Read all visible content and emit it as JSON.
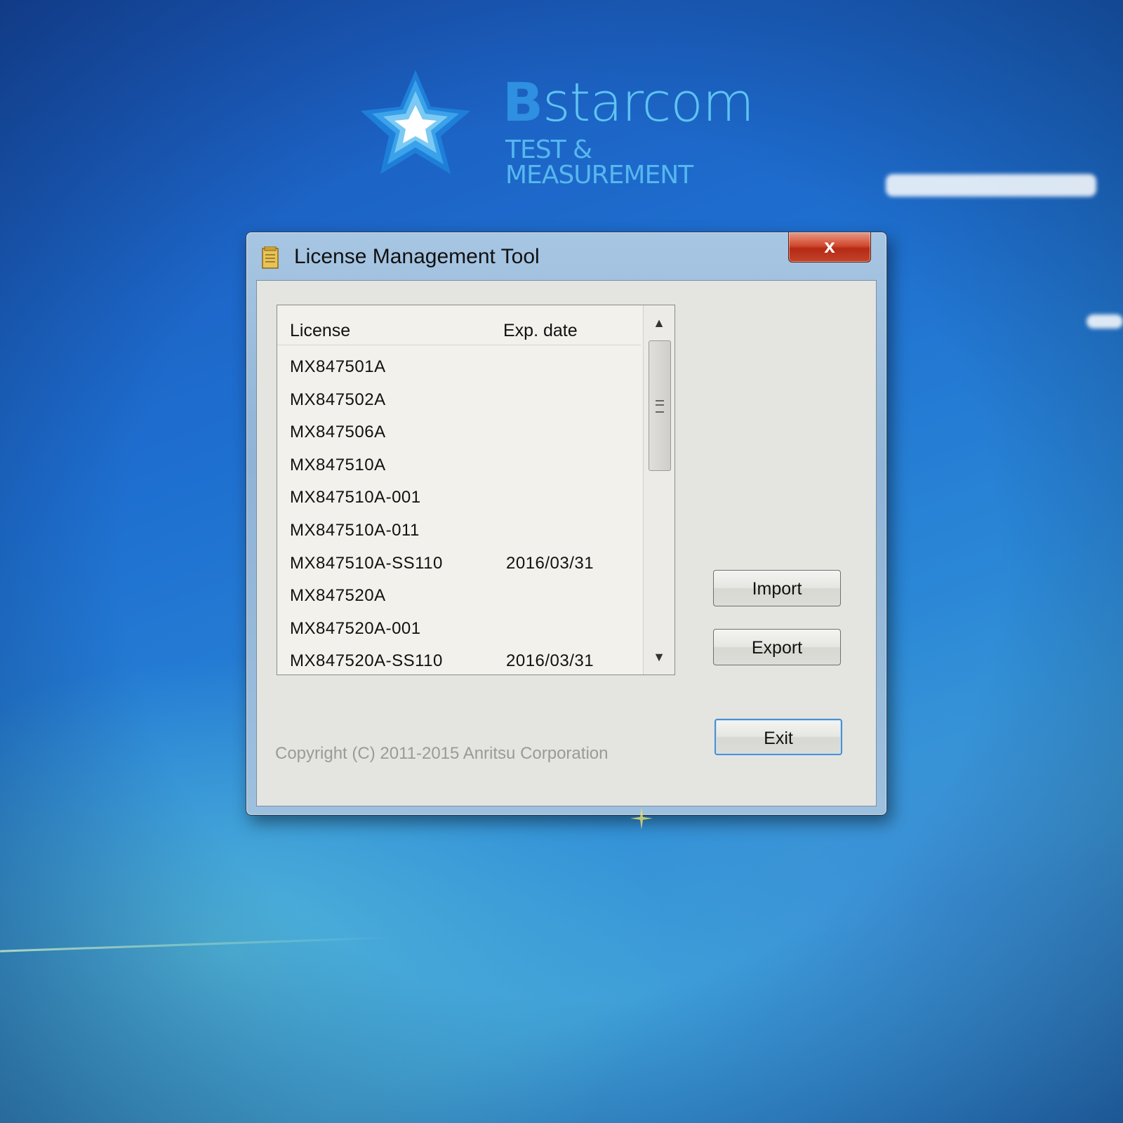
{
  "brand": {
    "initial": "B",
    "name_rest": "starcom",
    "subtitle": "TEST & MEASUREMENT"
  },
  "window": {
    "title": "License Management Tool",
    "close_label": "x",
    "icon": "document-icon"
  },
  "list": {
    "columns": {
      "license": "License",
      "exp_date": "Exp. date"
    },
    "rows": [
      {
        "license": "MX847501A",
        "exp": ""
      },
      {
        "license": "MX847502A",
        "exp": ""
      },
      {
        "license": "MX847506A",
        "exp": ""
      },
      {
        "license": "MX847510A",
        "exp": ""
      },
      {
        "license": "MX847510A-001",
        "exp": ""
      },
      {
        "license": "MX847510A-011",
        "exp": ""
      },
      {
        "license": "MX847510A-SS110",
        "exp": "2016/03/31"
      },
      {
        "license": "MX847520A",
        "exp": ""
      },
      {
        "license": "MX847520A-001",
        "exp": ""
      },
      {
        "license": "MX847520A-SS110",
        "exp": "2016/03/31"
      }
    ],
    "scroll_up_icon": "▲",
    "scroll_down_icon": "▼"
  },
  "buttons": {
    "import": "Import",
    "export": "Export",
    "exit": "Exit"
  },
  "footer": {
    "copyright": "Copyright (C) 2011-2015 Anritsu Corporation"
  },
  "colors": {
    "brand_light": "#5ec4f2",
    "brand_dark": "#2f8fe0",
    "close_red": "#c44328",
    "desktop_blue": "#1e6fd0"
  }
}
